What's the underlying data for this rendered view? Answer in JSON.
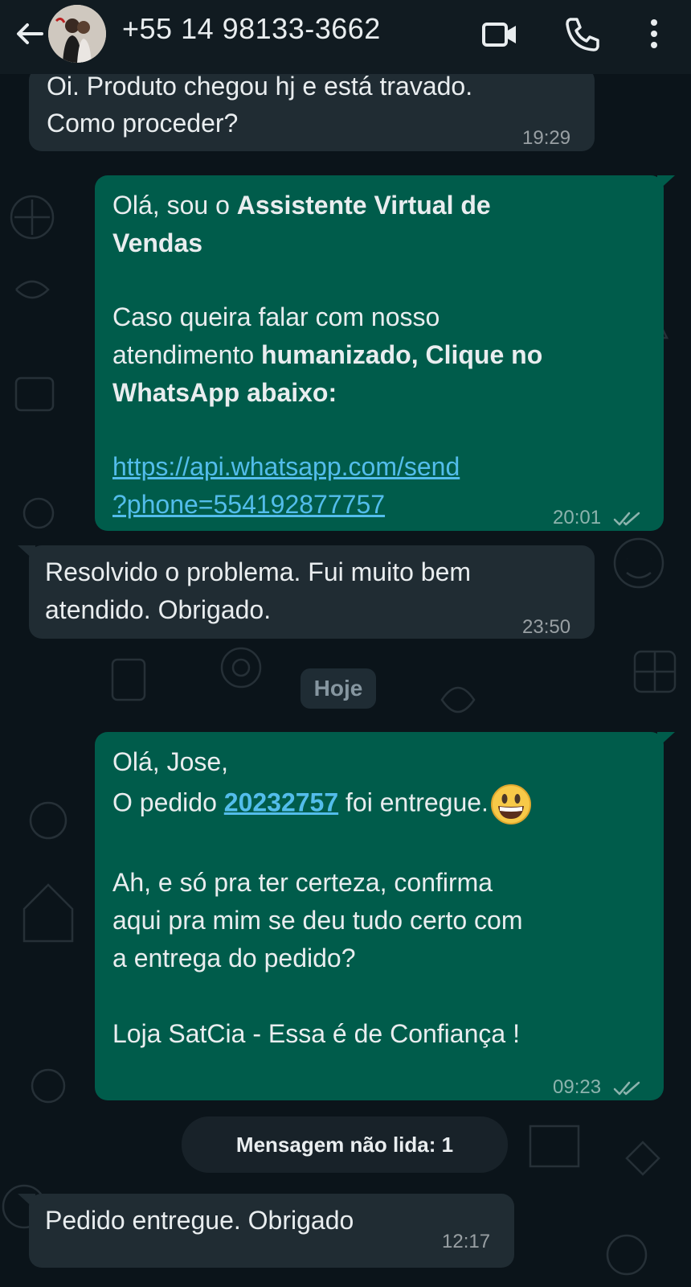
{
  "header": {
    "contact": "+55 14 98133-3662",
    "icons": [
      "back-arrow-icon",
      "video-call-icon",
      "phone-icon",
      "more-vert-icon"
    ]
  },
  "messages": [
    {
      "direction": "in",
      "lines": [
        "Oi. Produto chegou hj e está travado.",
        "Como proceder?"
      ],
      "time": "19:29"
    },
    {
      "direction": "out",
      "line1_plain": "Olá, sou o ",
      "line1_bold": "Assistente Virtual de",
      "line2_bold": "Vendas",
      "line3": "Caso queira falar com nosso",
      "line4_plain": "atendimento ",
      "line4_bold": "humanizado, Clique no",
      "line5_bold": "WhatsApp abaixo:",
      "link_line1": "https://api.whatsapp.com/send",
      "link_line2": "?phone=554192877757",
      "time": "20:01",
      "status": "read"
    },
    {
      "direction": "in",
      "lines": [
        "Resolvido o problema. Fui muito bem",
        "atendido. Obrigado."
      ],
      "time": "23:50"
    },
    {
      "direction": "out",
      "greeting": "Olá, Jose,",
      "order_prefix": "O pedido ",
      "order_number": "20232757",
      "order_suffix": " foi entregue.",
      "emoji": "grinning-face",
      "para2_lines": [
        "Ah, e só pra ter certeza, confirma",
        "aqui pra mim se deu tudo certo com",
        "a entrega do pedido?"
      ],
      "signature": "Loja SatCia - Essa é de Confiança !",
      "time": "09:23",
      "status": "read"
    },
    {
      "direction": "in",
      "lines": [
        "Pedido entregue. Obrigado"
      ],
      "time": "12:17"
    }
  ],
  "day_divider": "Hoje",
  "unread_divider": "Mensagem não lida: 1",
  "colors": {
    "background": "#0b141a",
    "header": "#111b21",
    "incoming_bubble": "#202c33",
    "outgoing_bubble": "#005c4b",
    "link": "#53bdeb"
  }
}
